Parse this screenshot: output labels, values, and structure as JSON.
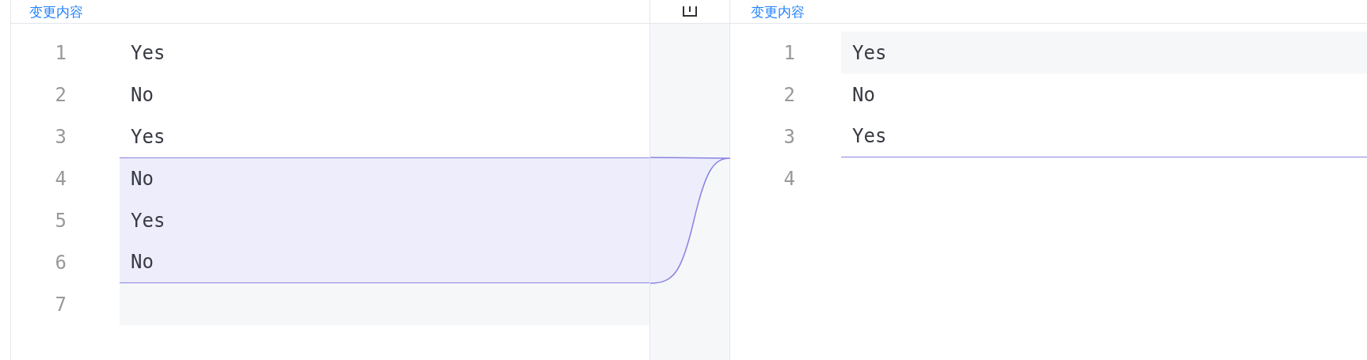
{
  "left": {
    "header": "变更内容",
    "lines": [
      {
        "number": "1",
        "text": "Yes",
        "kind": "normal"
      },
      {
        "number": "2",
        "text": "No",
        "kind": "normal"
      },
      {
        "number": "3",
        "text": "Yes",
        "kind": "normal"
      },
      {
        "number": "4",
        "text": "No",
        "kind": "removed"
      },
      {
        "number": "5",
        "text": "Yes",
        "kind": "removed"
      },
      {
        "number": "6",
        "text": "No",
        "kind": "removed"
      },
      {
        "number": "7",
        "kind": "blank"
      }
    ]
  },
  "right": {
    "header": "变更内容",
    "lines": [
      {
        "number": "1",
        "text": "Yes",
        "kind": "current"
      },
      {
        "number": "2",
        "text": "No",
        "kind": "normal"
      },
      {
        "number": "3",
        "text": "Yes",
        "kind": "insert-after"
      },
      {
        "number": "4",
        "kind": "normal"
      }
    ]
  }
}
